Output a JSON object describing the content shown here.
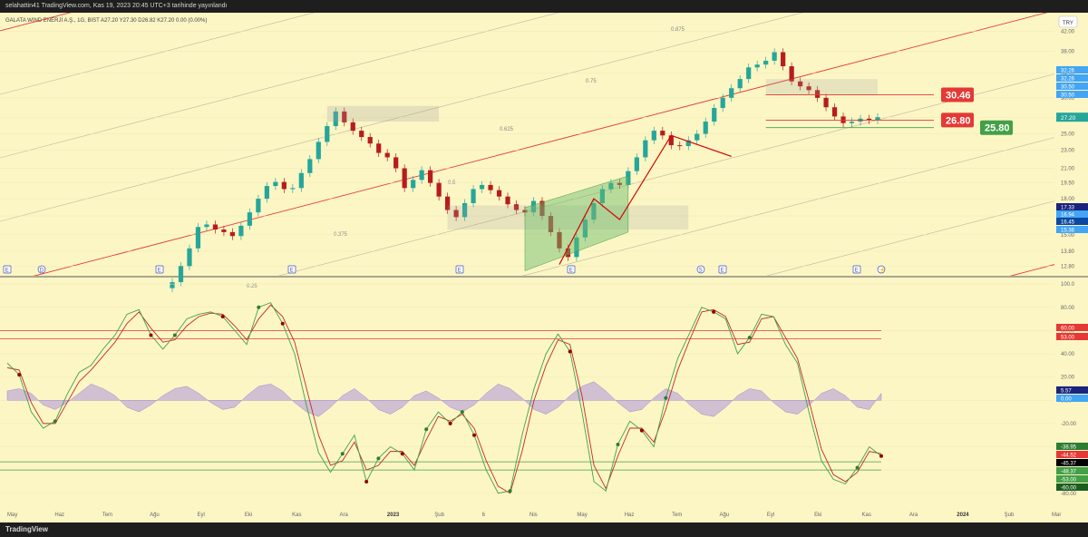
{
  "header": {
    "attribution": "selahattin41 TradingView.com, Kas 19, 2023 20:45 UTC+3 tarihinde yayınlandı",
    "legend": "GALATA WIND ENERJİ A.Ş., 1G, BIST  A27.20  Y27.30  D26.82  K27.20  0.00 (0.00%)",
    "currency": "TRY"
  },
  "footer": {
    "logo": "TradingView"
  },
  "colors": {
    "background": "#fcf6c5",
    "up": "#26a69a",
    "down": "#b71c1c",
    "channel": "#e53935",
    "fib": "#9e9e9e",
    "stoch_k": "#43a047",
    "stoch_d": "#c62828",
    "histogram": "#b39ddb"
  },
  "chart_data": [
    {
      "type": "candlestick",
      "name": "price",
      "x": [
        "May",
        "Haz",
        "Tem",
        "Ağu",
        "Eyl",
        "Eki",
        "Kas",
        "Ara",
        "2023",
        "Şub",
        "6",
        "Nis",
        "May",
        "Haz",
        "Tem",
        "Ağu",
        "Eyl",
        "Eki",
        "Kas",
        "Ara",
        "2024",
        "Şub",
        "Mar"
      ],
      "y_ticks": [
        42.0,
        38.0,
        34.0,
        30.0,
        27.2,
        25.0,
        23.0,
        21.0,
        19.5,
        18.0,
        16.5,
        15.0,
        13.8,
        12.8
      ],
      "y_tick_labels": [
        "42.00",
        "38.00",
        "34.00",
        "30.00",
        "27.20",
        "25.00",
        "23.00",
        "21.00",
        "19.50",
        "18.00",
        "16.50",
        "15.00",
        "13.80",
        "12.80"
      ],
      "ylim": [
        12.3,
        44.5
      ],
      "scale": "log",
      "last": 27.2,
      "close": [
        11.8,
        12.8,
        14.0,
        15.6,
        15.8,
        15.4,
        15.2,
        14.9,
        15.7,
        16.8,
        18.0,
        19.2,
        19.6,
        18.9,
        19.0,
        20.5,
        22.0,
        24.0,
        26.0,
        28.0,
        26.5,
        25.4,
        24.6,
        23.8,
        22.7,
        22.2,
        21.0,
        19.0,
        19.8,
        20.8,
        19.5,
        18.2,
        17.0,
        16.4,
        17.6,
        18.9,
        19.3,
        18.8,
        18.2,
        17.5,
        17.0,
        16.8,
        17.8,
        16.5,
        15.2,
        14.0,
        13.4,
        14.8,
        16.2,
        17.6,
        18.9,
        19.5,
        19.3,
        20.7,
        22.2,
        24.2,
        25.4,
        24.8,
        23.6,
        23.5,
        24.2,
        25.0,
        26.6,
        28.5,
        30.0,
        31.5,
        33.0,
        35.0,
        35.5,
        36.2,
        37.8,
        35.2,
        32.6,
        31.8,
        31.2,
        30.0,
        28.6,
        27.3,
        26.4,
        26.6,
        27.0,
        26.8,
        27.2
      ],
      "annotations": {
        "fib_levels": [
          "0.25",
          "0.375",
          "0.5",
          "0.625",
          "0.75",
          "0.875"
        ],
        "levels": [
          30.46,
          26.8,
          25.8
        ],
        "scale_badges": [
          "32.26",
          "32.26",
          "30.50",
          "30.50",
          "17.33",
          "16.94",
          "16.45",
          "15.36"
        ],
        "event_markers": [
          "E",
          "D",
          "E",
          "E",
          "E",
          "E",
          "S",
          "E",
          "E",
          "⚡"
        ]
      }
    },
    {
      "type": "line",
      "name": "stochastic_rsi",
      "y_ticks": [
        100,
        80,
        60,
        40,
        20,
        0,
        -20,
        -40,
        -60,
        -80
      ],
      "y_tick_labels": [
        "100.0",
        "80.00",
        "60.00",
        "40.00",
        "20.00",
        "0.00",
        "-20.00",
        "-40.00",
        "-60.00",
        "-80.00"
      ],
      "ylim": [
        -88,
        104
      ],
      "levels": [
        60.0,
        53.0,
        -53.0,
        -60.0
      ],
      "k": [
        32,
        22,
        -10,
        -24,
        -18,
        5,
        24,
        30,
        44,
        56,
        74,
        78,
        56,
        44,
        56,
        70,
        74,
        76,
        72,
        60,
        48,
        80,
        84,
        66,
        40,
        -5,
        -45,
        -62,
        -46,
        -30,
        -70,
        -50,
        -40,
        -46,
        -60,
        -25,
        -10,
        -20,
        -10,
        -30,
        -60,
        -80,
        -78,
        -30,
        10,
        40,
        57,
        42,
        -10,
        -70,
        -78,
        -38,
        -18,
        -26,
        -40,
        2,
        36,
        58,
        80,
        76,
        70,
        40,
        54,
        74,
        72,
        48,
        32,
        -12,
        -52,
        -68,
        -72,
        -58,
        -40,
        -48
      ],
      "d": [
        28,
        26,
        -2,
        -20,
        -20,
        -2,
        16,
        26,
        38,
        50,
        66,
        76,
        62,
        50,
        52,
        64,
        72,
        75,
        74,
        64,
        52,
        70,
        82,
        72,
        50,
        10,
        -30,
        -56,
        -52,
        -36,
        -60,
        -56,
        -44,
        -44,
        -56,
        -34,
        -14,
        -18,
        -12,
        -24,
        -52,
        -74,
        -80,
        -44,
        0,
        30,
        52,
        48,
        4,
        -56,
        -76,
        -48,
        -24,
        -24,
        -36,
        -8,
        26,
        52,
        76,
        78,
        72,
        48,
        50,
        70,
        72,
        54,
        36,
        -2,
        -42,
        -64,
        -70,
        -62,
        -44,
        -46
      ],
      "histogram": [
        8,
        10,
        6,
        -4,
        -8,
        -2,
        6,
        14,
        10,
        4,
        -6,
        -10,
        -4,
        4,
        10,
        12,
        6,
        -2,
        -8,
        -6,
        4,
        12,
        14,
        8,
        -2,
        -10,
        -14,
        -6,
        4,
        10,
        2,
        -8,
        -12,
        -6,
        4,
        8,
        2,
        -6,
        -10,
        -4,
        6,
        14,
        10,
        2,
        -8,
        -12,
        -6,
        4,
        12,
        16,
        8,
        -2,
        -10,
        -8,
        2,
        10,
        6,
        -4,
        -12,
        -14,
        -6,
        4,
        10,
        8,
        -2,
        -10,
        -12,
        -4,
        6,
        10,
        4,
        -6,
        -8,
        6
      ],
      "badges": [
        "60.00",
        "53.00",
        "5.57",
        "0.00",
        "-38.95",
        "-44.52",
        "-45.37",
        "-48.37",
        "-53.00",
        "-60.00"
      ]
    }
  ]
}
